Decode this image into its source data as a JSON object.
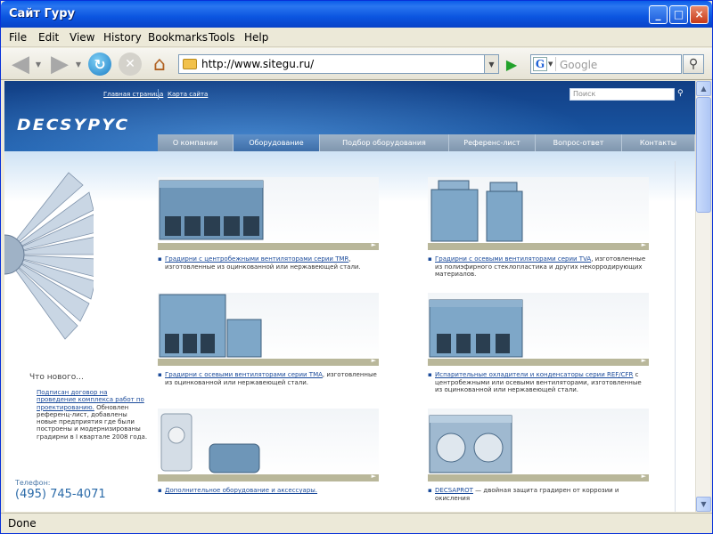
{
  "window": {
    "title": "Сайт Гуру",
    "minimize_label": "_",
    "maximize_label": "□",
    "close_label": "×"
  },
  "menu": {
    "items": [
      "File",
      "Edit",
      "View",
      "History",
      "Bookmarks",
      "Tools",
      "Help"
    ]
  },
  "navbar": {
    "url": "http://www.sitegu.ru/",
    "search_engine": "Google",
    "search_placeholder": "Google",
    "icons": {
      "back": "back-arrow-icon",
      "forward": "forward-arrow-icon",
      "reload": "reload-icon",
      "stop": "stop-icon",
      "home": "home-icon",
      "go": "go-arrow-icon",
      "search": "magnifier-icon"
    }
  },
  "site": {
    "top_links": [
      "Главная страница",
      "Карта сайта"
    ],
    "search_placeholder": "Поиск",
    "logo_text": "DECSYPYC",
    "tabs": [
      {
        "label": "О компании",
        "active": false
      },
      {
        "label": "Оборудование",
        "active": true
      },
      {
        "label": "Подбор оборудования",
        "active": false
      },
      {
        "label": "Референс-лист",
        "active": false
      },
      {
        "label": "Вопрос-ответ",
        "active": false
      },
      {
        "label": "Контакты",
        "active": false
      }
    ],
    "news": {
      "title": "Что нового...",
      "link_text": "Подписан договор на проведение комплекса работ по проектированию.",
      "body_text": " Обновлен референц-лист, добавлены новые предприятия где были построены и модернизированы градирни в I квартале 2008 года."
    },
    "phone": {
      "label": "Телефон:",
      "number": "(495) 745-4071"
    },
    "products": [
      {
        "link": "Градирни с центробежными вентиляторами серии TMR",
        "text": ", изготовленные из оцинкованной или нержавеющей стали."
      },
      {
        "link": "Градирни с осевыми вентиляторами серии TVA",
        "text": ", изготовленные из полиэфирного стеклопластика и других некорродирующих материалов."
      },
      {
        "link": "Градирни с осевыми вентиляторами серии TMA",
        "text": ", изготовленные из оцинкованной или нержавеющей стали."
      },
      {
        "link": "Испарительные охладители и конденсаторы серии REF/CFR",
        "text": " с центробежными или осевыми вентиляторами, изготовленные из оцинкованной или нержавеющей стали."
      },
      {
        "link": "Дополнительное оборудование и аксессуары.",
        "text": ""
      },
      {
        "link": "DECSAPROT",
        "text": " — двойная защита градирен от коррозии и окисления"
      }
    ]
  },
  "status": {
    "text": "Done"
  },
  "colors": {
    "xp_titlebar": "#0b55e0",
    "site_header": "#1a5aa8",
    "link": "#1a4a9a",
    "caption_bar": "#b9b79a",
    "phone": "#2a6aa8"
  }
}
